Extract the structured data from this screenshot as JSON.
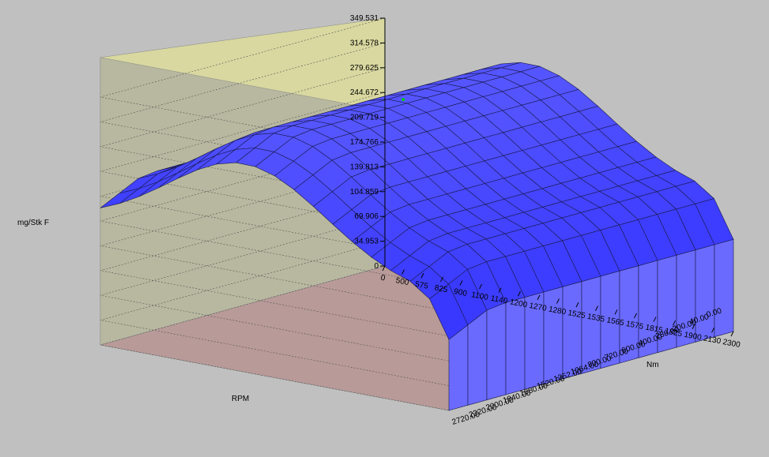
{
  "chart_data": {
    "type": "surface",
    "zlabel": "mg/Stk F",
    "xlabel": "RPM",
    "ylabel": "Nm",
    "zlim": [
      0,
      349.531
    ],
    "z_ticks": [
      "0",
      "34.953",
      "69.906",
      "104.859",
      "139.813",
      "174.766",
      "209.719",
      "244.672",
      "279.625",
      "314.578",
      "349.531"
    ],
    "x_ticks": [
      "0",
      "500",
      "575",
      "825",
      "900",
      "1100",
      "1140",
      "1200",
      "1270",
      "1280",
      "1525",
      "1535",
      "1565",
      "1575",
      "1815",
      "1825",
      "1900",
      "2130",
      "2300"
    ],
    "y_ticks": [
      "0.00",
      "40.00",
      "200.00",
      "280.00",
      "400.00",
      "600.00",
      "720.00",
      "800.00",
      "1064.00",
      "1352.00",
      "1520.00",
      "1680.00",
      "1840.00",
      "2000.00",
      "2320.00",
      "2720.00"
    ],
    "colors": {
      "surface": "#3333ff",
      "back_wall_left": "#d8d8a0",
      "back_wall_right": "#b8b8a0",
      "floor": "#b89a98",
      "marker": "#00cc00"
    }
  }
}
